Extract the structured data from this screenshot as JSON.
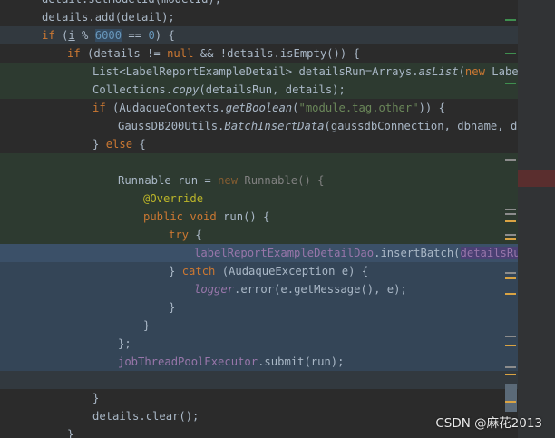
{
  "editor": {
    "lines": [
      [
        "detail.setModelId(modelId);"
      ],
      [
        "details.add(detail);"
      ],
      [
        "if",
        " (",
        "i",
        " % ",
        "6000",
        " == ",
        "0",
        ") {"
      ],
      [
        "if",
        " (details != ",
        "null",
        " && !details.isEmpty()) {"
      ],
      [
        "List<LabelReportExampleDetail> detailsRun=Arrays.",
        "asList",
        "(",
        "new",
        " LabelRe"
      ],
      [
        "Collections.",
        "copy",
        "(detailsRun, details);"
      ],
      [
        "if",
        " (AudaqueContexts.",
        "getBoolean",
        "(",
        "\"module.tag.other\"",
        ")) {"
      ],
      [
        "GaussDB200Utils.",
        "BatchInsertData",
        "(",
        "gaussdbConnection",
        ", ",
        "dbname",
        ", deta"
      ],
      [
        "} ",
        "else",
        " {"
      ],
      [
        ""
      ],
      [
        "Runnable run = ",
        "new",
        " ",
        "Runnable() {"
      ],
      [
        "@Override"
      ],
      [
        "public",
        " ",
        "void",
        " run() {"
      ],
      [
        "try",
        " {"
      ],
      [
        "labelReportExampleDetailDao",
        ".insertBatch(",
        "detailsRun",
        ")"
      ],
      [
        "} ",
        "catch",
        " (AudaqueException e) {"
      ],
      [
        "logger",
        ".error(e.getMessage(), e);"
      ],
      [
        "}"
      ],
      [
        "}"
      ],
      [
        "};"
      ],
      [
        "jobThreadPoolExecutor",
        ".submit(run);"
      ],
      [
        ""
      ],
      [
        "}"
      ],
      [
        "details.clear();"
      ],
      [
        "}"
      ]
    ]
  },
  "watermark": "CSDN @麻花2013",
  "colors": {
    "background": "#2b2b2b",
    "green_highlight": "#2d3a30",
    "blue_highlight": "#344557",
    "keyword": "#cc7832",
    "number": "#6897bb",
    "string": "#6a8759",
    "annotation": "#bbb529",
    "field": "#9876aa",
    "default_text": "#a9b7c6"
  }
}
